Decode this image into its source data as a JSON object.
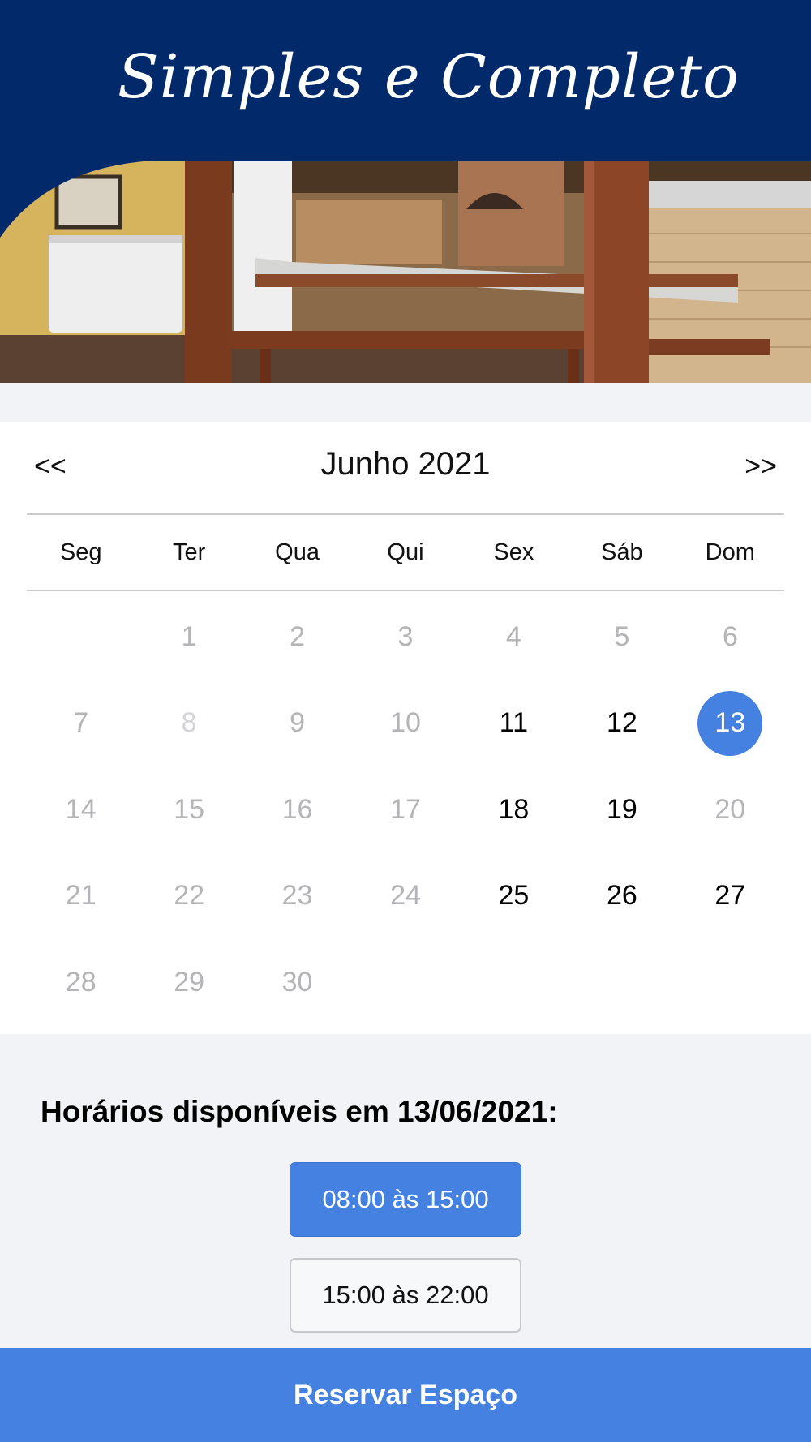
{
  "header": {
    "brand_text": "Simples e Completo"
  },
  "hero": {
    "image_name": "event-space-photo"
  },
  "calendar": {
    "prev_label": "<<",
    "next_label": ">>",
    "month_label": "Junho 2021",
    "weekdays": [
      "Seg",
      "Ter",
      "Qua",
      "Qui",
      "Sex",
      "Sáb",
      "Dom"
    ],
    "days": [
      {
        "label": "",
        "state": "empty"
      },
      {
        "label": "1",
        "state": "muted"
      },
      {
        "label": "2",
        "state": "muted"
      },
      {
        "label": "3",
        "state": "muted"
      },
      {
        "label": "4",
        "state": "muted"
      },
      {
        "label": "5",
        "state": "muted"
      },
      {
        "label": "6",
        "state": "muted"
      },
      {
        "label": "7",
        "state": "muted"
      },
      {
        "label": "8",
        "state": "faint"
      },
      {
        "label": "9",
        "state": "muted"
      },
      {
        "label": "10",
        "state": "muted"
      },
      {
        "label": "11",
        "state": "active"
      },
      {
        "label": "12",
        "state": "active"
      },
      {
        "label": "13",
        "state": "selected"
      },
      {
        "label": "14",
        "state": "muted"
      },
      {
        "label": "15",
        "state": "muted"
      },
      {
        "label": "16",
        "state": "muted"
      },
      {
        "label": "17",
        "state": "muted"
      },
      {
        "label": "18",
        "state": "active"
      },
      {
        "label": "19",
        "state": "active"
      },
      {
        "label": "20",
        "state": "muted"
      },
      {
        "label": "21",
        "state": "muted"
      },
      {
        "label": "22",
        "state": "muted"
      },
      {
        "label": "23",
        "state": "muted"
      },
      {
        "label": "24",
        "state": "muted"
      },
      {
        "label": "25",
        "state": "active"
      },
      {
        "label": "26",
        "state": "active"
      },
      {
        "label": "27",
        "state": "active"
      },
      {
        "label": "28",
        "state": "muted"
      },
      {
        "label": "29",
        "state": "muted"
      },
      {
        "label": "30",
        "state": "muted"
      }
    ]
  },
  "times": {
    "title": "Horários disponíveis em 13/06/2021:",
    "slots": [
      {
        "label": "08:00 às 15:00",
        "selected": true
      },
      {
        "label": "15:00 às 22:00",
        "selected": false
      }
    ]
  },
  "footer": {
    "reserve_label": "Reservar Espaço"
  },
  "colors": {
    "header_bg": "#022a6b",
    "accent": "#4581e0",
    "page_bg": "#f2f3f7"
  }
}
